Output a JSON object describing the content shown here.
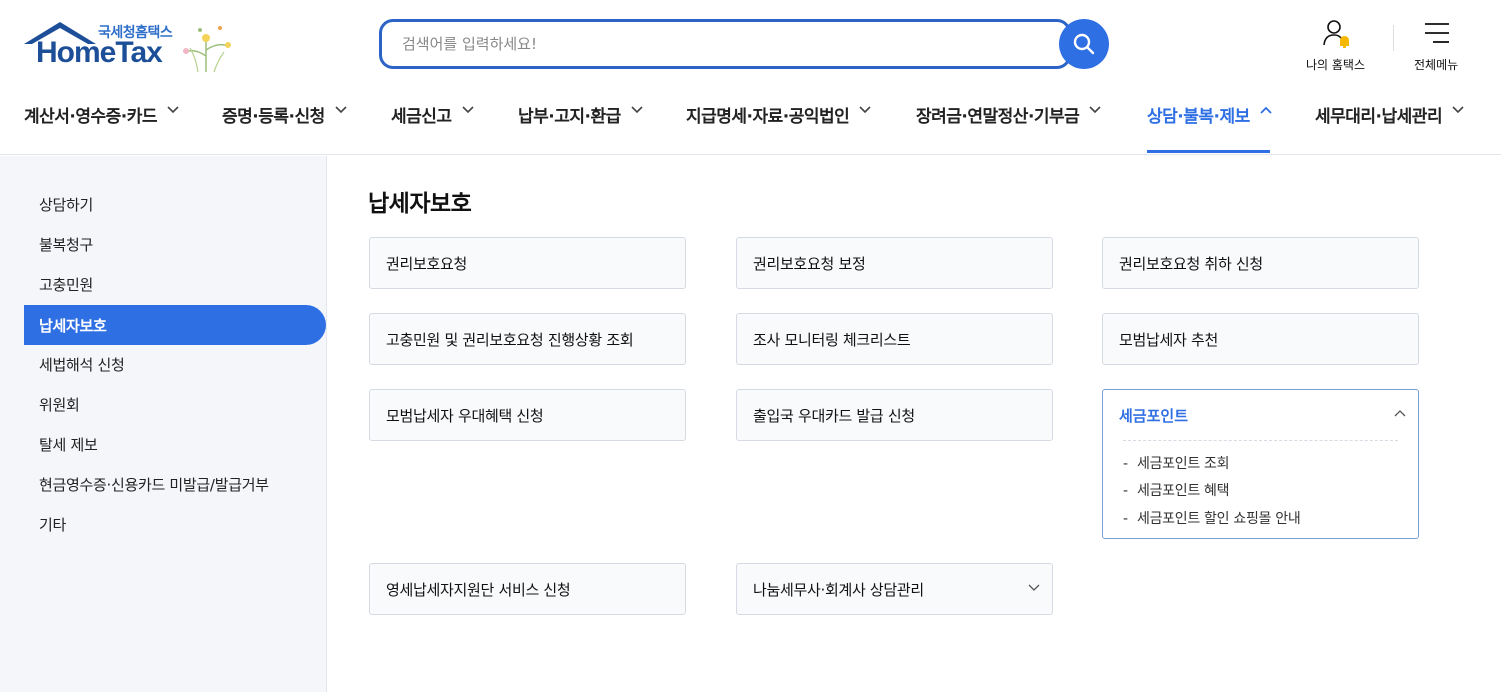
{
  "logo": {
    "kr": "국세청홈택스",
    "en": "HomeTax"
  },
  "search": {
    "placeholder": "검색어를 입력하세요!"
  },
  "utility": {
    "my_hometax": "나의 홈택스",
    "all_menu": "전체메뉴"
  },
  "accent_color": "#2f6fe4",
  "gnb": [
    {
      "label": "계산서·영수증·카드",
      "active": false
    },
    {
      "label": "증명·등록·신청",
      "active": false
    },
    {
      "label": "세금신고",
      "active": false
    },
    {
      "label": "납부·고지·환급",
      "active": false
    },
    {
      "label": "지급명세·자료·공익법인",
      "active": false
    },
    {
      "label": "장려금·연말정산·기부금",
      "active": false
    },
    {
      "label": "상담·불복·제보",
      "active": true
    },
    {
      "label": "세무대리·납세관리",
      "active": false
    }
  ],
  "sidebar": {
    "items": [
      {
        "label": "상담하기"
      },
      {
        "label": "불복청구"
      },
      {
        "label": "고충민원"
      },
      {
        "label": "납세자보호",
        "active": true
      },
      {
        "label": "세법해석 신청"
      },
      {
        "label": "위원회"
      },
      {
        "label": "탈세 제보"
      },
      {
        "label": "현금영수증·신용카드 미발급/발급거부"
      },
      {
        "label": "기타"
      }
    ]
  },
  "main": {
    "title": "납세자보호",
    "cards": [
      {
        "label": "권리보호요청"
      },
      {
        "label": "권리보호요청 보정"
      },
      {
        "label": "권리보호요청 취하 신청"
      },
      {
        "label": "고충민원 및 권리보호요청 진행상황 조회"
      },
      {
        "label": "조사 모니터링 체크리스트"
      },
      {
        "label": "모범납세자 추천"
      },
      {
        "label": "모범납세자 우대혜택 신청"
      },
      {
        "label": "출입국 우대카드 발급 신청"
      },
      {
        "label": "영세납세자지원단 서비스 신청"
      },
      {
        "label": "나눔세무사·회계사 상담관리"
      }
    ],
    "expanded_card": {
      "label": "세금포인트",
      "sub_items": [
        {
          "label": "세금포인트 조회"
        },
        {
          "label": "세금포인트 혜택"
        },
        {
          "label": "세금포인트 할인 쇼핑몰 안내"
        }
      ]
    }
  }
}
